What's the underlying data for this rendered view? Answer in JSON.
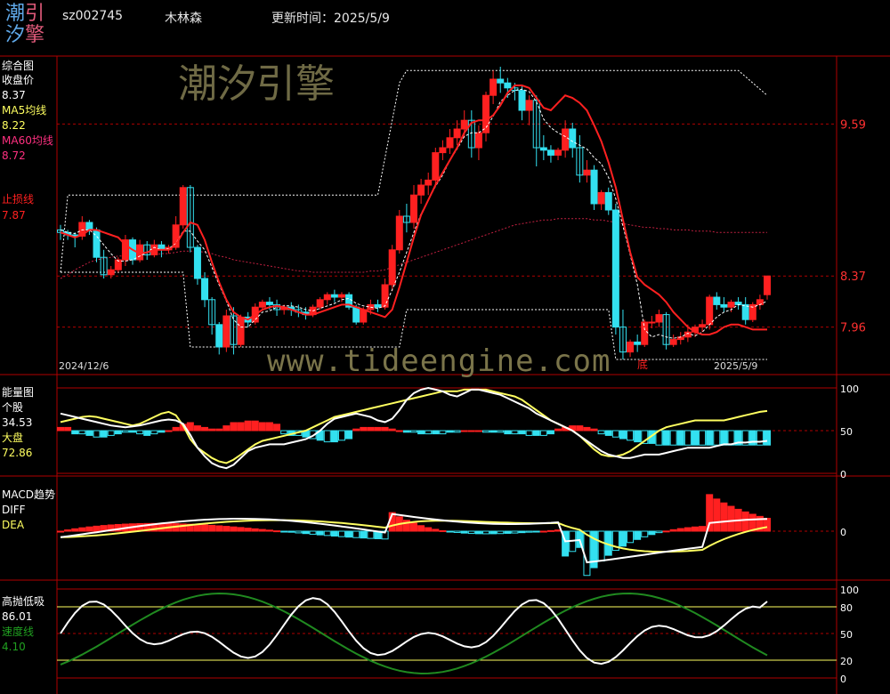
{
  "header": {
    "logo_chars": [
      "潮",
      "引",
      "汐",
      "擎"
    ],
    "code": "sz002745",
    "name": "木林森",
    "update_label": "更新时间：",
    "update_date": "2025/5/9"
  },
  "watermarks": {
    "brand_cn": "潮汐引擎",
    "url": "www.tideengine.com"
  },
  "colors": {
    "up": "#ff2020",
    "down": "#33e0f0",
    "ma5": "#ffff60",
    "ma60": "#ff3040",
    "stop": "#ff2020",
    "grid": "#b00000",
    "white": "#ffffff",
    "green": "#208a20"
  },
  "panels": {
    "main": {
      "title": "综合图",
      "close_label": "收盘价",
      "close_value": "8.37",
      "ma5_label": "MA5均线",
      "ma5_value": "8.22",
      "ma60_label": "MA60均线",
      "ma60_value": "8.72",
      "stop_label": "止损线",
      "stop_value": "7.87",
      "date_start": "2024/12/6",
      "date_end": "2025/5/9",
      "marker": "底"
    },
    "energy": {
      "title": "能量图",
      "stock_label": "个股",
      "stock_value": "34.53",
      "market_label": "大盘",
      "market_value": "72.86"
    },
    "macd": {
      "title": "MACD趋势",
      "diff_label": "DIFF",
      "dea_label": "DEA"
    },
    "hilo": {
      "title": "高抛低吸",
      "value": "86.01",
      "speed_label": "速度线",
      "speed_value": "4.10"
    }
  },
  "chart_data": [
    {
      "type": "candlestick",
      "title": "综合图",
      "price_ticks": [
        9.59,
        8.37,
        7.96
      ],
      "ylim": [
        7.6,
        10.1
      ],
      "candles": [
        [
          8.74,
          8.78,
          8.72,
          8.66
        ],
        [
          8.72,
          8.74,
          8.7,
          8.66
        ],
        [
          8.7,
          8.72,
          8.69,
          8.6
        ],
        [
          8.69,
          8.85,
          8.8,
          8.66
        ],
        [
          8.8,
          8.82,
          8.74,
          8.7
        ],
        [
          8.74,
          8.76,
          8.52,
          8.48
        ],
        [
          8.52,
          8.58,
          8.38,
          8.35
        ],
        [
          8.38,
          8.45,
          8.42,
          8.35
        ],
        [
          8.42,
          8.52,
          8.5,
          8.4
        ],
        [
          8.5,
          8.7,
          8.66,
          8.45
        ],
        [
          8.66,
          8.68,
          8.5,
          8.46
        ],
        [
          8.5,
          8.66,
          8.62,
          8.48
        ],
        [
          8.62,
          8.65,
          8.54,
          8.5
        ],
        [
          8.54,
          8.66,
          8.62,
          8.52
        ],
        [
          8.62,
          8.65,
          8.58,
          8.52
        ],
        [
          8.58,
          8.62,
          8.6,
          8.55
        ],
        [
          8.6,
          8.85,
          8.78,
          8.58
        ],
        [
          8.78,
          9.1,
          9.08,
          8.75
        ],
        [
          9.08,
          9.1,
          8.6,
          8.56
        ],
        [
          8.6,
          8.62,
          8.35,
          8.3
        ],
        [
          8.35,
          8.4,
          8.18,
          8.12
        ],
        [
          8.18,
          8.2,
          7.98,
          7.9
        ],
        [
          7.98,
          8.0,
          7.8,
          7.74
        ],
        [
          7.8,
          8.1,
          8.05,
          7.76
        ],
        [
          8.05,
          8.12,
          7.82,
          7.74
        ],
        [
          7.82,
          8.06,
          8.04,
          7.8
        ],
        [
          8.04,
          8.08,
          8.0,
          7.96
        ],
        [
          8.0,
          8.15,
          8.12,
          7.98
        ],
        [
          8.12,
          8.18,
          8.16,
          8.1
        ],
        [
          8.16,
          8.2,
          8.14,
          8.1
        ],
        [
          8.14,
          8.18,
          8.1,
          8.05
        ],
        [
          8.1,
          8.14,
          8.12,
          8.06
        ],
        [
          8.12,
          8.16,
          8.1,
          8.05
        ],
        [
          8.1,
          8.14,
          8.08,
          8.04
        ],
        [
          8.08,
          8.12,
          8.06,
          8.02
        ],
        [
          8.06,
          8.14,
          8.12,
          8.04
        ],
        [
          8.12,
          8.2,
          8.18,
          8.1
        ],
        [
          8.18,
          8.24,
          8.22,
          8.14
        ],
        [
          8.22,
          8.26,
          8.2,
          8.16
        ],
        [
          8.2,
          8.24,
          8.22,
          8.16
        ],
        [
          8.22,
          8.24,
          8.12,
          8.1
        ],
        [
          8.12,
          8.14,
          8.0,
          7.98
        ],
        [
          8.0,
          8.12,
          8.1,
          7.98
        ],
        [
          8.1,
          8.18,
          8.14,
          8.06
        ],
        [
          8.14,
          8.18,
          8.12,
          8.08
        ],
        [
          8.12,
          8.35,
          8.3,
          8.1
        ],
        [
          8.3,
          8.62,
          8.58,
          8.25
        ],
        [
          8.58,
          8.9,
          8.85,
          8.55
        ],
        [
          8.85,
          8.95,
          8.8,
          8.72
        ],
        [
          8.8,
          9.1,
          9.02,
          8.75
        ],
        [
          9.02,
          9.15,
          9.1,
          8.95
        ],
        [
          9.1,
          9.2,
          9.14,
          9.02
        ],
        [
          9.14,
          9.4,
          9.36,
          9.1
        ],
        [
          9.36,
          9.46,
          9.4,
          9.3
        ],
        [
          9.4,
          9.55,
          9.48,
          9.35
        ],
        [
          9.48,
          9.62,
          9.55,
          9.42
        ],
        [
          9.55,
          9.7,
          9.62,
          9.48
        ],
        [
          9.62,
          9.7,
          9.4,
          9.32
        ],
        [
          9.4,
          9.58,
          9.52,
          9.3
        ],
        [
          9.52,
          9.85,
          9.82,
          9.45
        ],
        [
          9.82,
          10.02,
          9.95,
          9.75
        ],
        [
          9.95,
          10.05,
          9.92,
          9.84
        ],
        [
          9.92,
          9.96,
          9.88,
          9.8
        ],
        [
          9.88,
          9.92,
          9.86,
          9.78
        ],
        [
          9.86,
          9.9,
          9.7,
          9.62
        ],
        [
          9.7,
          9.82,
          9.78,
          9.58
        ],
        [
          9.78,
          9.82,
          9.4,
          9.25
        ],
        [
          9.4,
          9.5,
          9.38,
          9.3
        ],
        [
          9.38,
          9.42,
          9.34,
          9.28
        ],
        [
          9.34,
          9.4,
          9.38,
          9.3
        ],
        [
          9.38,
          9.62,
          9.55,
          9.32
        ],
        [
          9.55,
          9.6,
          9.4,
          9.32
        ],
        [
          9.4,
          9.5,
          9.18,
          9.12
        ],
        [
          9.18,
          9.3,
          9.22,
          9.12
        ],
        [
          9.22,
          9.26,
          8.95,
          8.9
        ],
        [
          8.95,
          9.06,
          9.04,
          8.9
        ],
        [
          9.04,
          9.08,
          8.9,
          8.86
        ],
        [
          8.9,
          8.95,
          7.96,
          7.9
        ],
        [
          7.96,
          8.1,
          7.76,
          7.7
        ],
        [
          7.76,
          7.86,
          7.84,
          7.72
        ],
        [
          7.84,
          7.9,
          7.82,
          7.76
        ],
        [
          7.82,
          8.02,
          8.0,
          7.8
        ],
        [
          8.0,
          8.05,
          8.0,
          7.95
        ],
        [
          8.0,
          8.1,
          8.06,
          7.96
        ],
        [
          8.06,
          8.08,
          7.82,
          7.78
        ],
        [
          7.82,
          7.9,
          7.86,
          7.8
        ],
        [
          7.86,
          7.92,
          7.88,
          7.82
        ],
        [
          7.88,
          7.98,
          7.92,
          7.84
        ],
        [
          7.92,
          7.98,
          7.96,
          7.88
        ],
        [
          7.96,
          8.02,
          7.98,
          7.92
        ],
        [
          7.98,
          8.22,
          8.2,
          7.94
        ],
        [
          8.2,
          8.24,
          8.14,
          8.1
        ],
        [
          8.14,
          8.2,
          8.12,
          8.08
        ],
        [
          8.12,
          8.18,
          8.16,
          8.08
        ],
        [
          8.16,
          8.2,
          8.14,
          8.1
        ],
        [
          8.14,
          8.2,
          8.02,
          7.98
        ],
        [
          8.02,
          8.16,
          8.14,
          8.0
        ],
        [
          8.14,
          8.22,
          8.18,
          8.1
        ],
        [
          8.22,
          8.37,
          8.37,
          8.18
        ]
      ],
      "ma5": [
        8.74,
        8.72,
        8.71,
        8.74,
        8.74,
        8.69,
        8.62,
        8.55,
        8.49,
        8.49,
        8.5,
        8.53,
        8.56,
        8.6,
        8.58,
        8.59,
        8.63,
        8.73,
        8.73,
        8.65,
        8.58,
        8.44,
        8.3,
        8.17,
        8.02,
        7.96,
        7.96,
        8.02,
        8.08,
        8.09,
        8.12,
        8.13,
        8.13,
        8.12,
        8.1,
        8.09,
        8.11,
        8.13,
        8.15,
        8.18,
        8.19,
        8.15,
        8.13,
        8.12,
        8.11,
        8.13,
        8.26,
        8.4,
        8.56,
        8.72,
        8.87,
        8.98,
        9.09,
        9.18,
        9.3,
        9.39,
        9.49,
        9.52,
        9.52,
        9.56,
        9.65,
        9.77,
        9.82,
        9.86,
        9.87,
        9.85,
        9.77,
        9.63,
        9.56,
        9.52,
        9.49,
        9.45,
        9.42,
        9.39,
        9.32,
        9.27,
        9.16,
        8.99,
        8.77,
        8.54,
        8.3,
        7.94,
        7.88,
        7.9,
        7.88,
        7.87,
        7.88,
        7.91,
        7.89,
        7.92,
        7.98,
        8.04,
        8.08,
        8.1,
        8.14,
        8.13,
        8.12,
        8.14,
        8.17
      ],
      "ma60": [
        8.35,
        8.38,
        8.42,
        8.45,
        8.48,
        8.5,
        8.51,
        8.52,
        8.53,
        8.53,
        8.53,
        8.54,
        8.54,
        8.54,
        8.55,
        8.55,
        8.56,
        8.57,
        8.57,
        8.57,
        8.56,
        8.55,
        8.53,
        8.52,
        8.5,
        8.49,
        8.48,
        8.47,
        8.46,
        8.45,
        8.44,
        8.43,
        8.42,
        8.41,
        8.41,
        8.4,
        8.4,
        8.4,
        8.4,
        8.4,
        8.4,
        8.4,
        8.4,
        8.41,
        8.41,
        8.42,
        8.44,
        8.46,
        8.48,
        8.5,
        8.52,
        8.54,
        8.56,
        8.58,
        8.6,
        8.62,
        8.64,
        8.66,
        8.68,
        8.7,
        8.72,
        8.74,
        8.76,
        8.78,
        8.79,
        8.8,
        8.81,
        8.82,
        8.82,
        8.83,
        8.83,
        8.83,
        8.83,
        8.83,
        8.82,
        8.82,
        8.81,
        8.8,
        8.79,
        8.78,
        8.77,
        8.76,
        8.76,
        8.75,
        8.75,
        8.74,
        8.74,
        8.74,
        8.73,
        8.73,
        8.73,
        8.72,
        8.72,
        8.72,
        8.72,
        8.72,
        8.72,
        8.72,
        8.72
      ],
      "stop_line": [
        8.72,
        8.7,
        8.68,
        8.7,
        8.74,
        8.74,
        8.72,
        8.7,
        8.68,
        8.62,
        8.58,
        8.55,
        8.56,
        8.58,
        8.58,
        8.58,
        8.62,
        8.72,
        8.8,
        8.78,
        8.66,
        8.48,
        8.32,
        8.18,
        8.08,
        8.04,
        8.02,
        8.06,
        8.1,
        8.12,
        8.13,
        8.12,
        8.1,
        8.08,
        8.06,
        8.06,
        8.08,
        8.1,
        8.12,
        8.14,
        8.14,
        8.12,
        8.1,
        8.08,
        8.06,
        8.04,
        8.1,
        8.28,
        8.48,
        8.68,
        8.86,
        8.98,
        9.1,
        9.2,
        9.3,
        9.4,
        9.52,
        9.6,
        9.62,
        9.62,
        9.66,
        9.74,
        9.84,
        9.9,
        9.9,
        9.88,
        9.8,
        9.72,
        9.7,
        9.76,
        9.82,
        9.8,
        9.76,
        9.7,
        9.58,
        9.45,
        9.28,
        9.08,
        8.82,
        8.56,
        8.36,
        8.3,
        8.26,
        8.22,
        8.16,
        8.08,
        8.02,
        7.96,
        7.92,
        7.9,
        7.9,
        7.92,
        7.96,
        7.98,
        7.98,
        7.96,
        7.94,
        7.94,
        7.94
      ],
      "upper_band": [
        8.7,
        8.7,
        8.7,
        8.7,
        8.7,
        8.7,
        8.7,
        8.7,
        8.7,
        8.7,
        8.7,
        8.7,
        8.7,
        8.7,
        8.7,
        8.7,
        8.7,
        8.7,
        8.7,
        8.7,
        8.7,
        8.7,
        8.7,
        8.7,
        8.7,
        8.7,
        8.7,
        8.7,
        8.7,
        8.7,
        8.7,
        8.7,
        8.7,
        8.7,
        8.7,
        8.7,
        8.7,
        8.7,
        8.7,
        8.7,
        8.7,
        8.7,
        8.7,
        8.7,
        8.7,
        8.7,
        8.7,
        8.7,
        8.7,
        8.7,
        8.7,
        8.7,
        8.7,
        8.7,
        8.7,
        8.7,
        8.7,
        8.7,
        8.7,
        8.7,
        8.7,
        8.7,
        8.7,
        8.7,
        8.7,
        8.7,
        8.7,
        8.7,
        8.7,
        8.7,
        8.7,
        8.7,
        8.7,
        8.7,
        8.7,
        8.7,
        8.7,
        8.7,
        8.7,
        8.7,
        8.7,
        8.7,
        8.7,
        8.7,
        8.7,
        8.7,
        8.7,
        8.7,
        8.7,
        8.7,
        8.7,
        8.7,
        8.7,
        8.7,
        8.7,
        8.7,
        8.7,
        8.7,
        8.7
      ]
    },
    {
      "type": "line+bar",
      "title": "能量图",
      "ylim": [
        0,
        100
      ],
      "ticks": [
        100,
        50,
        0
      ]
    },
    {
      "type": "line+bar",
      "title": "MACD趋势",
      "ticks": [
        0
      ]
    },
    {
      "type": "line",
      "title": "高抛低吸",
      "ylim": [
        0,
        100
      ],
      "ticks": [
        100,
        80,
        50,
        20,
        0
      ]
    }
  ]
}
